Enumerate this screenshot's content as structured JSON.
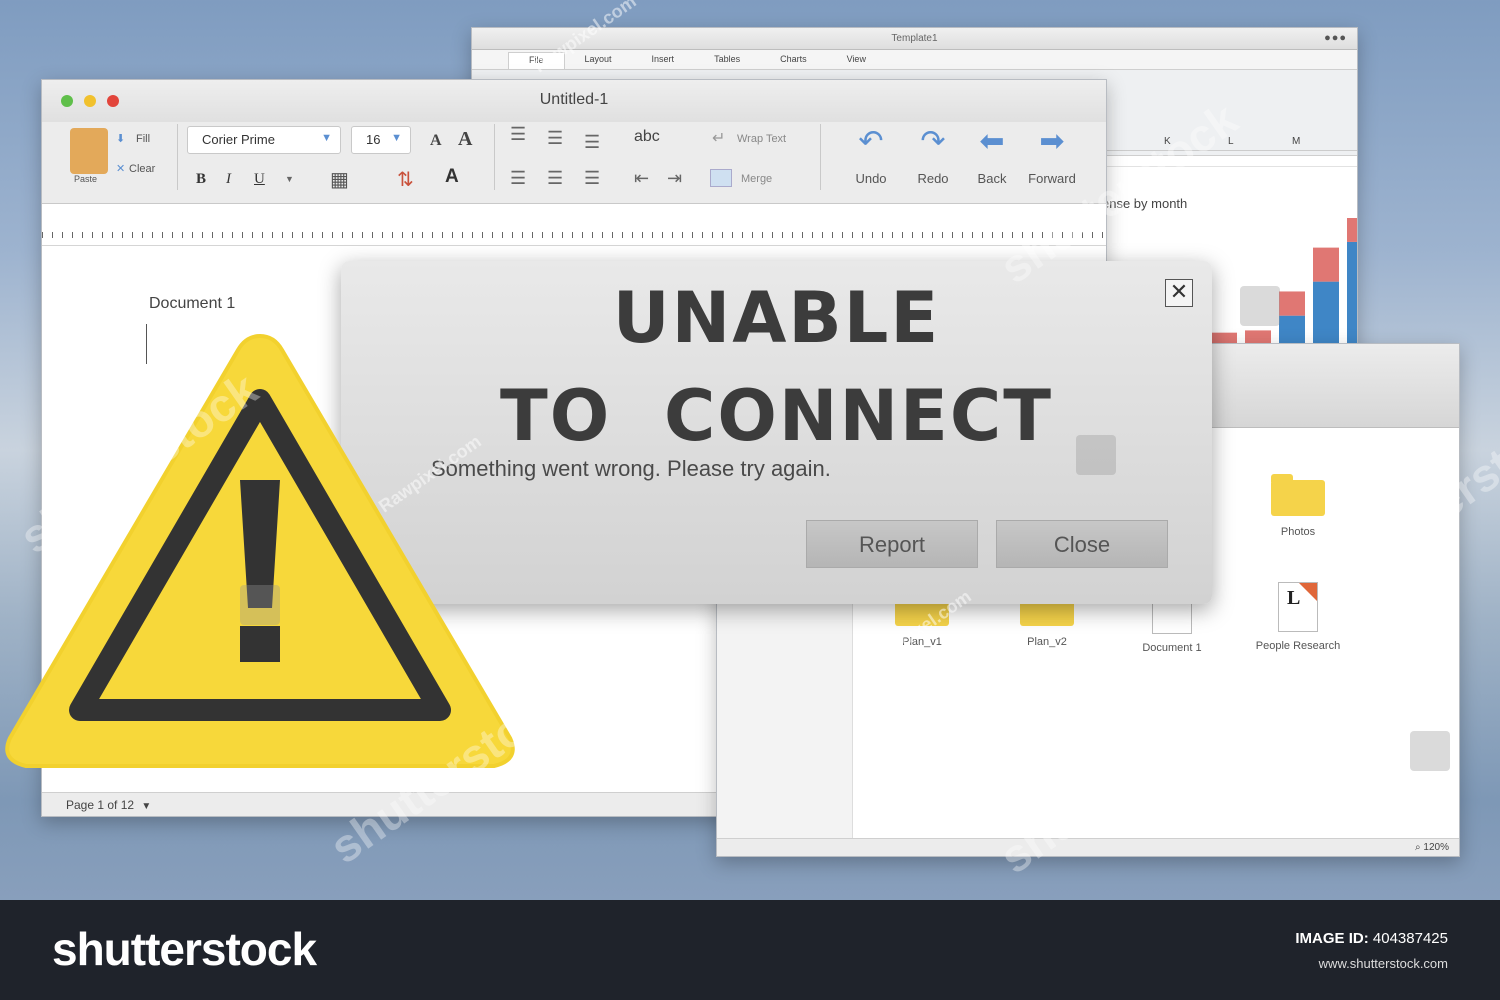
{
  "sheet_window": {
    "title": "Template1",
    "tabs": [
      "File",
      "Layout",
      "Insert",
      "Tables",
      "Charts",
      "View"
    ],
    "columns": [
      "K",
      "L",
      "M"
    ],
    "chart_title": "ense by month",
    "bars": [
      {
        "red": 0.15,
        "blue": 0.0
      },
      {
        "red": 0.18,
        "blue": 0.0
      },
      {
        "red": 0.32,
        "blue": 0.25
      },
      {
        "red": 0.45,
        "blue": 0.55
      },
      {
        "red": 0.6,
        "blue": 0.9
      }
    ]
  },
  "word_window": {
    "title": "Untitled-1",
    "toolbar": {
      "paste": "Paste",
      "fill": "Fill",
      "clear": "Clear",
      "font_name": "Corier Prime",
      "font_size": "16",
      "bold": "B",
      "italic": "I",
      "underline": "U",
      "abc": "abc",
      "wrap_text": "Wrap Text",
      "merge": "Merge",
      "undo": "Undo",
      "redo": "Redo",
      "back": "Back",
      "forward": "Forward"
    },
    "document_label": "Document 1",
    "status": "Page 1 of 12"
  },
  "finder_window": {
    "items": [
      "Photos",
      "Plan_v1",
      "Plan_v2",
      "Document 1",
      "People Research"
    ],
    "zoom": "120%"
  },
  "dialog": {
    "line1": "UNABLE",
    "line2": "TO  CONNECT",
    "message": "Something went wrong. Please try again.",
    "report": "Report",
    "close": "Close",
    "close_icon": "✕"
  },
  "watermark": {
    "text": "shutterstock",
    "rawpixel": "Rawpixel.com"
  },
  "footer": {
    "logo": "shutterstock",
    "image_id_label": "IMAGE ID:",
    "image_id": "404387425",
    "url": "www.shutterstock.com"
  },
  "colors": {
    "warning_yellow": "#f7d83a",
    "warning_dark": "#333333",
    "accent_blue": "#5b8fd1",
    "bar_red": "#e07773",
    "bar_blue": "#3f86c6"
  }
}
